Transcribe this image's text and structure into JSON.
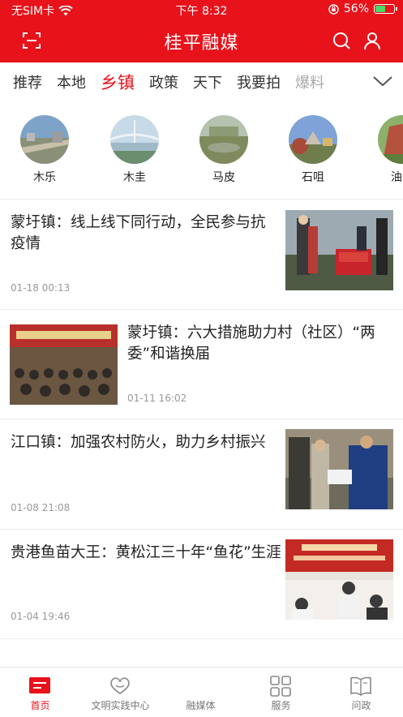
{
  "status_bar": {
    "carrier": "无SIM卡",
    "time": "下午 8:32",
    "battery": "56%",
    "battery_level": 0.56
  },
  "header": {
    "title": "桂平融媒",
    "icons": [
      "scan-icon",
      "search-icon",
      "user-icon"
    ]
  },
  "tabs": [
    "推荐",
    "本地",
    "乡镇",
    "政策",
    "天下",
    "我要拍",
    "爆料"
  ],
  "active_tab": "乡镇",
  "towns": [
    "木乐",
    "木圭",
    "马皮",
    "石咀",
    "油"
  ],
  "news": [
    {
      "title": "蒙圩镇：线上线下同行动，全民参与抗疫情",
      "time": "01-18 00:13"
    },
    {
      "title": "蒙圩镇：六大措施助力村（社区）“两委”和谐换届",
      "time": "01-11 16:02"
    },
    {
      "title": "江口镇：加强农村防火，助力乡村振兴",
      "time": "01-08 21:08"
    },
    {
      "title": "贵港鱼苗大王：黄松江三十年“鱼花”生涯",
      "time": "01-04 19:46"
    }
  ],
  "bottom_nav": [
    "首页",
    "文明实践中心",
    "融媒体",
    "服务",
    "问政"
  ],
  "colors": {
    "accent": "#e8121b"
  }
}
